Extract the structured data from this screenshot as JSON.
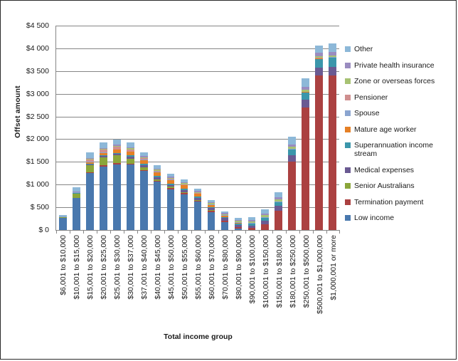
{
  "chart": {
    "type": "bar",
    "title": "",
    "xlabel": "Total income group",
    "ylabel": "Offset amount"
  },
  "yaxis": {
    "ticks": [
      "$4 500",
      "$4 000",
      "$3 500",
      "$3 000",
      "$2 500",
      "$2 000",
      "$1 500",
      "$1 000",
      "$ 500",
      "$ 0"
    ],
    "min": 0,
    "max": 4500,
    "step": 500
  },
  "legend": {
    "items": [
      {
        "label": "Other",
        "color": "#8db8d8"
      },
      {
        "label": "Private health insurance",
        "color": "#9a8cc0"
      },
      {
        "label": "Zone or overseas forces",
        "color": "#a7c273"
      },
      {
        "label": "Pensioner",
        "color": "#cf8f8f"
      },
      {
        "label": "Spouse",
        "color": "#8ba5d0"
      },
      {
        "label": "Mature age worker",
        "color": "#e58026"
      },
      {
        "label": "Superannuation income stream",
        "color": "#3b96ab"
      },
      {
        "label": "Medical expenses",
        "color": "#6a5a92"
      },
      {
        "label": "Senior Australians",
        "color": "#8ba63a"
      },
      {
        "label": "Termination payment",
        "color": "#ab4141"
      },
      {
        "label": "Low income",
        "color": "#4978ae"
      }
    ]
  },
  "chart_data": {
    "type": "bar",
    "subtype": "stacked-column",
    "title": "",
    "xlabel": "Total income group",
    "ylabel": "Offset amount",
    "ylim": [
      0,
      4500
    ],
    "ytick_step": 500,
    "grid": true,
    "legend_position": "right",
    "currency": "AUD",
    "categories": [
      "$6,001 to $10,000",
      "$10,001 to $15,000",
      "$15,001 to $20,000",
      "$20,001 to $25,000",
      "$25,001 to $30,000",
      "$30,001 to $37,000",
      "$37,001 to $40,000",
      "$40,001 to $45,000",
      "$45,001 to $50,000",
      "$50,001 to $55,000",
      "$55,001 to $60,000",
      "$60,001 to $70,000",
      "$70,001 to $80,000",
      "$80,001 to $90,000",
      "$90,001 to $100,000",
      "$100,001 to $150,000",
      "$150,001 to $180,000",
      "$180,001 to $250,000",
      "$250,001 to $500,000",
      "$500,001 to $1,000,000",
      "$1,000,001 or more"
    ],
    "series": [
      {
        "name": "Low income",
        "color": "#4978ae",
        "values": [
          260,
          700,
          1250,
          1400,
          1450,
          1440,
          1300,
          1060,
          900,
          790,
          620,
          400,
          180,
          30,
          0,
          0,
          0,
          0,
          0,
          0,
          0
        ]
      },
      {
        "name": "Termination payment",
        "color": "#ab4141",
        "values": [
          0,
          0,
          20,
          20,
          20,
          25,
          25,
          25,
          25,
          25,
          25,
          25,
          25,
          30,
          40,
          130,
          420,
          1500,
          2700,
          3400,
          3400
        ]
      },
      {
        "name": "Senior Australians",
        "color": "#8ba63a",
        "values": [
          20,
          95,
          160,
          175,
          170,
          105,
          60,
          35,
          25,
          20,
          15,
          10,
          5,
          0,
          0,
          0,
          0,
          0,
          0,
          0,
          0
        ]
      },
      {
        "name": "Medical expenses",
        "color": "#6a5a92",
        "values": [
          5,
          10,
          20,
          30,
          35,
          45,
          45,
          45,
          45,
          50,
          50,
          50,
          50,
          50,
          55,
          80,
          110,
          150,
          170,
          180,
          190
        ]
      },
      {
        "name": "Superannuation income stream",
        "color": "#3b96ab",
        "values": [
          5,
          10,
          15,
          20,
          25,
          25,
          25,
          25,
          25,
          25,
          25,
          25,
          30,
          35,
          40,
          55,
          80,
          120,
          160,
          190,
          200
        ]
      },
      {
        "name": "Mature age worker",
        "color": "#e58026",
        "values": [
          0,
          5,
          30,
          55,
          65,
          80,
          85,
          85,
          80,
          75,
          60,
          40,
          25,
          15,
          10,
          8,
          5,
          5,
          5,
          5,
          5
        ]
      },
      {
        "name": "Spouse",
        "color": "#8ba5d0",
        "values": [
          2,
          5,
          10,
          12,
          12,
          12,
          10,
          10,
          10,
          8,
          8,
          8,
          8,
          8,
          8,
          10,
          10,
          10,
          10,
          10,
          10
        ]
      },
      {
        "name": "Pensioner",
        "color": "#cf8f8f",
        "values": [
          5,
          10,
          50,
          60,
          55,
          45,
          30,
          20,
          15,
          12,
          10,
          8,
          5,
          5,
          5,
          5,
          5,
          5,
          5,
          5,
          5
        ]
      },
      {
        "name": "Zone or overseas forces",
        "color": "#a7c273",
        "values": [
          2,
          5,
          15,
          20,
          25,
          25,
          25,
          25,
          25,
          25,
          25,
          25,
          25,
          30,
          35,
          40,
          40,
          40,
          35,
          30,
          25
        ]
      },
      {
        "name": "Private health insurance",
        "color": "#9a8cc0",
        "values": [
          5,
          10,
          15,
          20,
          20,
          20,
          20,
          20,
          20,
          20,
          20,
          20,
          20,
          25,
          30,
          40,
          50,
          60,
          70,
          80,
          90
        ]
      },
      {
        "name": "Other",
        "color": "#8db8d8",
        "values": [
          25,
          95,
          125,
          125,
          120,
          110,
          90,
          75,
          65,
          60,
          55,
          45,
          40,
          45,
          55,
          85,
          120,
          170,
          190,
          170,
          190
        ]
      }
    ]
  }
}
